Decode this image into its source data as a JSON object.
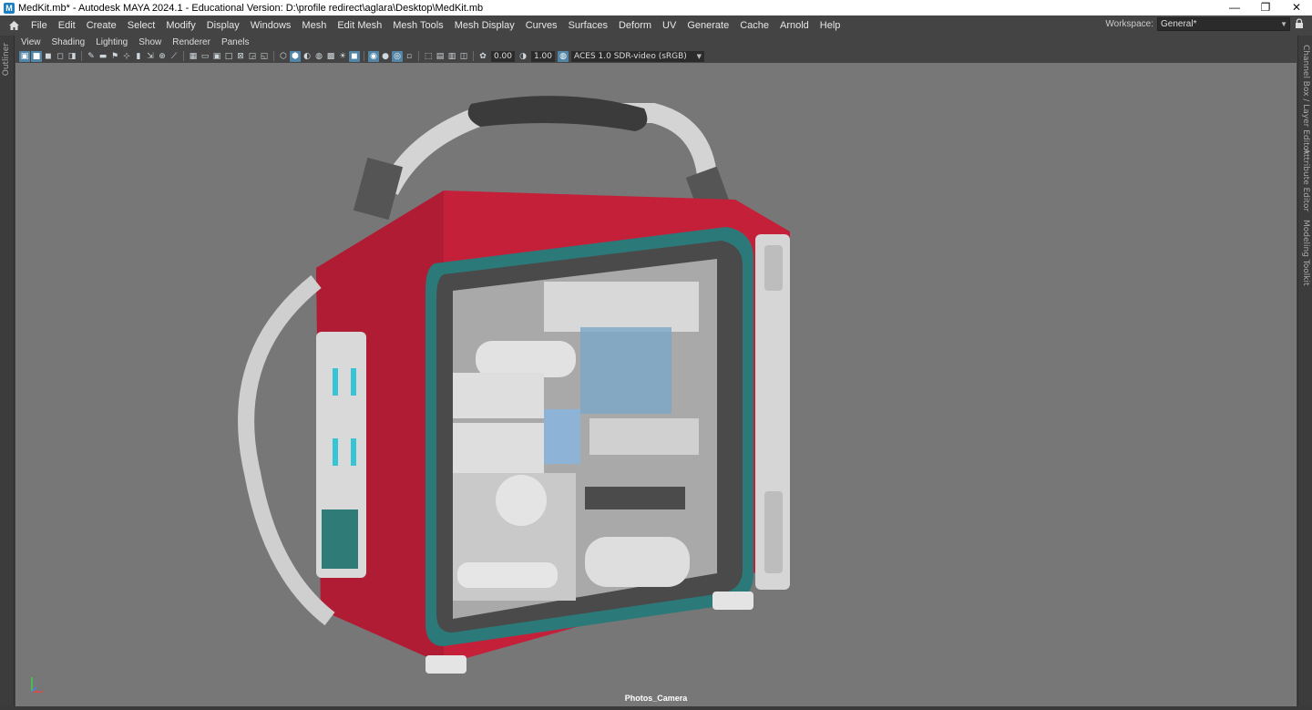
{
  "window": {
    "title": "MedKit.mb* - Autodesk MAYA 2024.1 - Educational Version: D:\\profile redirect\\aglara\\Desktop\\MedKit.mb",
    "minimize_glyph": "—",
    "restore_glyph": "❐",
    "close_glyph": "✕",
    "app_icon_letter": "M"
  },
  "menubar": {
    "home_icon": "home-icon",
    "items": [
      "File",
      "Edit",
      "Create",
      "Select",
      "Modify",
      "Display",
      "Windows",
      "Mesh",
      "Edit Mesh",
      "Mesh Tools",
      "Mesh Display",
      "Curves",
      "Surfaces",
      "Deform",
      "UV",
      "Generate",
      "Cache",
      "Arnold",
      "Help"
    ],
    "workspace_label": "Workspace:",
    "workspace_value": "General*"
  },
  "side_tabs": {
    "left": "Outliner",
    "right": [
      "Channel Box / Layer Editor",
      "Attribute Editor",
      "Modeling Toolkit"
    ]
  },
  "panel_menu": [
    "View",
    "Shading",
    "Lighting",
    "Show",
    "Renderer",
    "Panels"
  ],
  "viewport_toolbar": {
    "exposure": "0.00",
    "gamma": "1.00",
    "color_space": "ACES 1.0 SDR-video (sRGB)"
  },
  "viewport": {
    "camera_label": "Photos_Camera",
    "background_color": "#777777",
    "model_primary_color": "#c8223a",
    "model_accent_color": "#2a7d7c"
  }
}
